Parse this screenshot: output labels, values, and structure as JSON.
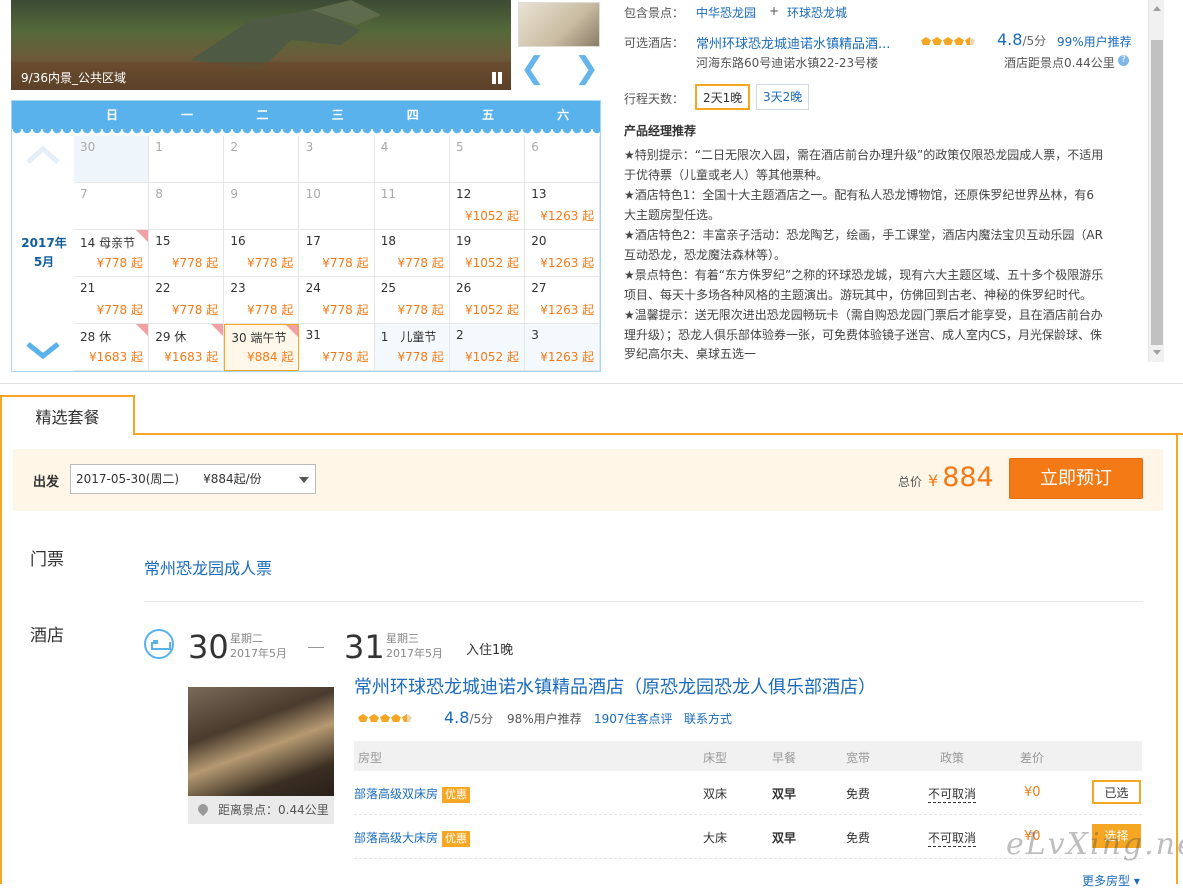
{
  "gallery": {
    "caption": "9/36内景_公共区域",
    "prev_arrow": "❮",
    "next_arrow": "❯"
  },
  "calendar": {
    "weekdays": [
      "日",
      "一",
      "二",
      "三",
      "四",
      "五",
      "六"
    ],
    "year_label": "2017年",
    "month_label": "5月",
    "weeks": [
      [
        {
          "d": "30",
          "p": "",
          "g": true,
          "today": true
        },
        {
          "d": "1",
          "p": "",
          "g": true
        },
        {
          "d": "2",
          "p": "",
          "g": true
        },
        {
          "d": "3",
          "p": "",
          "g": true
        },
        {
          "d": "4",
          "p": "",
          "g": true
        },
        {
          "d": "5",
          "p": "",
          "g": true
        },
        {
          "d": "6",
          "p": "",
          "g": true
        }
      ],
      [
        {
          "d": "7",
          "p": "",
          "g": true
        },
        {
          "d": "8",
          "p": "",
          "g": true
        },
        {
          "d": "9",
          "p": "",
          "g": true
        },
        {
          "d": "10",
          "p": "",
          "g": true
        },
        {
          "d": "11",
          "p": "",
          "g": true
        },
        {
          "d": "12",
          "p": "¥1052 起"
        },
        {
          "d": "13",
          "p": "¥1263 起"
        }
      ],
      [
        {
          "d": "14 母亲节",
          "p": "¥778 起",
          "c": true
        },
        {
          "d": "15",
          "p": "¥778 起"
        },
        {
          "d": "16",
          "p": "¥778 起"
        },
        {
          "d": "17",
          "p": "¥778 起"
        },
        {
          "d": "18",
          "p": "¥778 起"
        },
        {
          "d": "19",
          "p": "¥1052 起"
        },
        {
          "d": "20",
          "p": "¥1263 起"
        }
      ],
      [
        {
          "d": "21",
          "p": "¥778 起"
        },
        {
          "d": "22",
          "p": "¥778 起"
        },
        {
          "d": "23",
          "p": "¥778 起"
        },
        {
          "d": "24",
          "p": "¥778 起"
        },
        {
          "d": "25",
          "p": "¥778 起"
        },
        {
          "d": "26",
          "p": "¥1052 起"
        },
        {
          "d": "27",
          "p": "¥1263 起"
        }
      ],
      [
        {
          "d": "28 休",
          "p": "¥1683 起",
          "c": true
        },
        {
          "d": "29 休",
          "p": "¥1683 起",
          "c": true
        },
        {
          "d": "30 端午节",
          "p": "¥884 起",
          "c": true,
          "sel": true
        },
        {
          "d": "31",
          "p": "¥778 起"
        },
        {
          "d": "1　儿童节",
          "p": "¥778 起",
          "lb": true
        },
        {
          "d": "2",
          "p": "¥1052 起",
          "lb": true
        },
        {
          "d": "3",
          "p": "¥1263 起",
          "lb": true
        }
      ]
    ]
  },
  "info": {
    "spots_label": "包含景点：",
    "spots": [
      "中华恐龙园",
      "环球恐龙城"
    ],
    "spots_plus": "+",
    "hotel_label": "可选酒店：",
    "hotel_name": "常州环球恐龙城迪诺水镇精品酒...",
    "hotel_score": "4.8",
    "hotel_score_unit": "/5分",
    "hotel_rec": "99%用户推荐",
    "hotel_address": "河海东路60号迪诺水镇22-23号楼",
    "hotel_distance": "酒店距景点0.44公里",
    "help_icon": "?",
    "days_label": "行程天数：",
    "day_options": [
      "2天1晚",
      "3天2晚"
    ],
    "pm_title": "产品经理推荐",
    "pm_paragraphs": [
      "★特别提示：“二日无限次入园，需在酒店前台办理升级”的政策仅限恐龙园成人票，不适用于优待票（儿童或老人）等其他票种。",
      "★酒店特色1：全国十大主题酒店之一。配有私人恐龙博物馆，还原侏罗纪世界丛林，有6大主题房型任选。",
      "★酒店特色2：丰富亲子活动：恐龙陶艺，绘画，手工课堂，酒店内魔法宝贝互动乐园（AR互动恐龙，恐龙魔法森林等）。",
      "★景点特色：有着“东方侏罗纪”之称的环球恐龙城，现有六大主题区域、五十多个极限游乐项目、每天十多场各种风格的主题演出。游玩其中，仿佛回到古老、神秘的侏罗纪时代。",
      "★温馨提示：送无限次进出恐龙园畅玩卡（需自购恐龙园门票后才能享受，且在酒店前台办理升级）；恐龙人俱乐部体验券一张，可免费体验镜子迷宫、成人室内CS，月光保龄球、侏罗纪高尔夫、桌球五选一"
    ]
  },
  "package": {
    "tab_label": "精选套餐",
    "depart_label": "出发",
    "depart_value": "2017-05-30(周二)　　¥884起/份",
    "total_label": "总价",
    "currency": "¥",
    "total_value": "884",
    "book_label": "立即预订",
    "ticket_section": "门票",
    "ticket_name": "常州恐龙园成人票",
    "hotel_section": "酒店",
    "checkin_day": "30",
    "checkin_week": "星期二",
    "checkin_month": "2017年5月",
    "checkout_day": "31",
    "checkout_week": "星期三",
    "checkout_month": "2017年5月",
    "stay_text": "入住1晚",
    "hotel_full_name": "常州环球恐龙城迪诺水镇精品酒店（原恐龙园恐龙人俱乐部酒店）",
    "hotel_score": "4.8",
    "hotel_score_unit": "/5分",
    "hotel_rec": "98%用户推荐",
    "hotel_reviews": "1907住客点评",
    "hotel_contact": "联系方式",
    "hotel_distance": "距离景点：0.44公里",
    "room_headers": [
      "房型",
      "床型",
      "早餐",
      "宽带",
      "政策",
      "差价"
    ],
    "rooms": [
      {
        "name": "部落高级双床房",
        "tag": "优惠",
        "bed": "双床",
        "breakfast": "双早",
        "wifi": "免费",
        "policy": "不可取消",
        "diff": "¥0",
        "action": "已选"
      },
      {
        "name": "部落高级大床房",
        "tag": "优惠",
        "bed": "大床",
        "breakfast": "双早",
        "wifi": "免费",
        "policy": "不可取消",
        "diff": "¥0",
        "action": "选择"
      }
    ],
    "more_rooms": "更多房型 ▾"
  },
  "watermark": "eLvXing.net"
}
